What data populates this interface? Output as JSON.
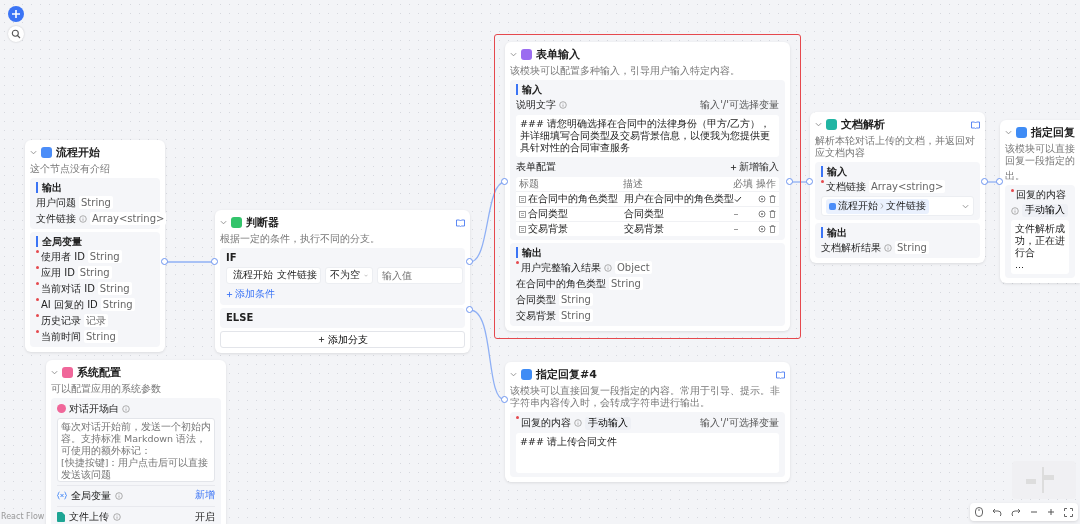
{
  "start_node": {
    "title": "流程开始",
    "description": "这个节点没有介绍",
    "sections": [
      {
        "title": "输出",
        "fields": [
          {
            "label": "用户问题",
            "type": "String",
            "required": false,
            "help": false
          },
          {
            "label": "文件链接",
            "type": "Array<string>",
            "required": false,
            "help": true
          }
        ]
      },
      {
        "title": "全局变量",
        "fields": [
          {
            "label": "使用者 ID",
            "type": "String",
            "required": true,
            "help": false
          },
          {
            "label": "应用 ID",
            "type": "String",
            "required": true,
            "help": false
          },
          {
            "label": "当前对话 ID",
            "type": "String",
            "required": true,
            "help": false
          },
          {
            "label": "AI 回复的 ID",
            "type": "String",
            "required": true,
            "help": false
          },
          {
            "label": "历史记录",
            "type": "记录",
            "required": true,
            "help": false
          },
          {
            "label": "当前时间",
            "type": "String",
            "required": true,
            "help": false
          }
        ]
      }
    ]
  },
  "system_config": {
    "title": "系统配置",
    "description": "可以配置应用的系统参数",
    "opening": {
      "label": "对话开场白",
      "help": true,
      "placeholder": "每次对话开始前，发送一个初始内容。支持标准 Markdown 语法，可使用的额外标记：\n[快捷按键]：用户点击后可以直接发送该问题"
    },
    "rows": [
      {
        "kind": "variables",
        "label": "全局变量",
        "help": true,
        "action": "新增"
      },
      {
        "kind": "upload",
        "label": "文件上传",
        "help": true,
        "value": "开启"
      }
    ]
  },
  "condition_node": {
    "title": "判断器",
    "description": "根据一定的条件，执行不同的分支。",
    "branches": [
      {
        "kind": "if",
        "label": "IF",
        "conditions": [
          {
            "source": "流程开始",
            "field": "文件链接",
            "operator": "不为空",
            "value_placeholder": "输入值"
          }
        ],
        "add_condition": "添加条件"
      },
      {
        "kind": "else",
        "label": "ELSE"
      }
    ],
    "add_branch": "添加分支"
  },
  "form_input_node": {
    "selected": true,
    "title": "表单输入",
    "description": "该模块可以配置多种输入，引导用户输入特定内容。",
    "input": {
      "title": "输入",
      "prompt_label": "说明文字",
      "prompt_hint": "输入'/'可选择变量",
      "prompt_text": "### 请您明确选择在合同中的法律身份（甲方/乙方），并详细填写合同类型及交易背景信息，以便我为您提供更具针对性的合同审查服务",
      "form_label": "表单配置",
      "add_label": "新增输入",
      "columns": [
        "标题",
        "描述",
        "必填",
        "操作"
      ],
      "rows": [
        {
          "title": "在合同中的角色类型",
          "description": "用户在合同中的角色类型",
          "required": true
        },
        {
          "title": "合同类型",
          "description": "合同类型",
          "required": false
        },
        {
          "title": "交易背景",
          "description": "交易背景",
          "required": false
        }
      ]
    },
    "output": {
      "title": "输出",
      "fields": [
        {
          "label": "用户完整输入结果",
          "type": "Object",
          "required": true,
          "help": true
        },
        {
          "label": "在合同中的角色类型",
          "type": "String",
          "required": false,
          "help": false
        },
        {
          "label": "合同类型",
          "type": "String",
          "required": false,
          "help": false
        },
        {
          "label": "交易背景",
          "type": "String",
          "required": false,
          "help": false
        }
      ]
    }
  },
  "reply_node_4": {
    "title": "指定回复#4",
    "description": "该模块可以直接回复一段指定的内容。常用于引导、提示。非字符串内容传入时，会转成字符串进行输出。",
    "field": {
      "label": "回复的内容",
      "required": true,
      "help": true,
      "mode": "手动输入",
      "hint": "输入'/'可选择变量",
      "content": "### 请上传合同文件"
    }
  },
  "doc_parse_node": {
    "title": "文档解析",
    "description": "解析本轮对话上传的文档，并返回对应文档内容",
    "input": {
      "title": "输入",
      "field": {
        "label": "文档链接",
        "required": true,
        "type": "Array<string>",
        "source": "流程开始",
        "source_field": "文件链接"
      }
    },
    "output": {
      "title": "输出",
      "fields": [
        {
          "label": "文档解析结果",
          "type": "String",
          "required": false,
          "help": true
        }
      ]
    }
  },
  "reply_node": {
    "title": "指定回复",
    "description_lines": [
      "该模块可以直接回复一段指定的",
      "出。"
    ],
    "field": {
      "label": "回复的内容",
      "required": true,
      "help": true,
      "mode": "手动输入",
      "content_lines": [
        "文件解析成功，正在进行合",
        "..."
      ]
    }
  },
  "attribution": "React Flow"
}
